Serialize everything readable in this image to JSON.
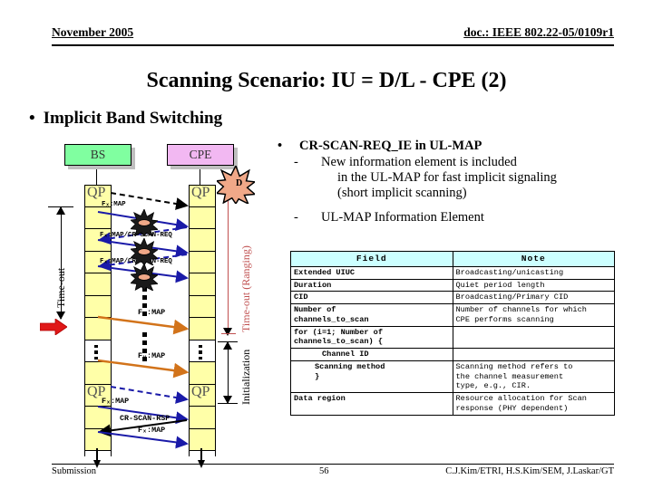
{
  "header": {
    "left": "November 2005",
    "right": "doc.: IEEE 802.22-05/0109r1"
  },
  "title": "Scanning Scenario: IU = D/L - CPE (2)",
  "main_bullet": {
    "marker": "•",
    "text": "Implicit Band Switching"
  },
  "right_text": {
    "bullet_marker": "•",
    "heading": "CR-SCAN-REQ_IE in UL-MAP",
    "dash": "-",
    "sub1_line1": "New information element is included",
    "sub1_line2": "in the UL-MAP for fast implicit signaling",
    "sub1_line3": "(short implicit scanning)",
    "sub2": "UL-MAP Information Element"
  },
  "table": {
    "headers": [
      "Field",
      "Note"
    ],
    "rows": [
      {
        "field": "Extended UIUC",
        "note": "Broadcasting/unicasting",
        "indent": 0
      },
      {
        "field": "Duration",
        "note": "Quiet period length",
        "indent": 0
      },
      {
        "field": "CID",
        "note": "Broadcasting/Primary CID",
        "indent": 0
      },
      {
        "field": "Number of\nchannels_to_scan",
        "note": "Number of channels for which\nCPE performs scanning",
        "indent": 0
      },
      {
        "field": "for (i=1; Number of\nchannels_to_scan) {",
        "note": "",
        "indent": 0
      },
      {
        "field": "Channel ID",
        "note": "",
        "indent": 1
      },
      {
        "field": "Scanning method\n}",
        "note": "Scanning method refers to\nthe channel measurement\ntype, e.g., CIR.",
        "indent": 2
      },
      {
        "field": "Data region",
        "note": "Resource allocation for Scan\nresponse (PHY dependent)",
        "indent": 0
      }
    ],
    "header_bg": "#ccffff"
  },
  "diagram": {
    "bs_label": "BS",
    "cpe_label": "CPE",
    "bs_color": "#80ffa0",
    "cpe_color": "#f2b8f2",
    "cell_color": "#ffffa8",
    "qp_label": "QP",
    "burst_d_label": "D",
    "burst_color": "#f0a888",
    "left_axis_label": "Time-out",
    "right_axis_label_1": "Time-out (Ranging)",
    "right_axis_label_1_color": "#c05050",
    "right_axis_label_2": "Initialization",
    "messages": [
      {
        "label": "",
        "kind": "dashed-black"
      },
      {
        "label": "Fₓ:MAP",
        "kind": "solid-blue"
      },
      {
        "label": "",
        "kind": "dashed-blue"
      },
      {
        "label": "Fₓ:MAP/CR-SCAN-REQ",
        "kind": "solid-blue"
      },
      {
        "label": "",
        "kind": "dashed-blue"
      },
      {
        "label": "Fₓ:MAP/CR-SCAN-REQ",
        "kind": "solid-blue"
      },
      {
        "label": "Fᵧ:MAP",
        "kind": "solid-orange"
      },
      {
        "label": "Fᵧ:MAP",
        "kind": "solid-orange"
      },
      {
        "label": "",
        "kind": "dashed-blue"
      },
      {
        "label": "Fₓ:MAP",
        "kind": "solid-blue"
      },
      {
        "label": "CR-SCAN-RSP",
        "kind": "solid-black"
      },
      {
        "label": "Fₓ:MAP",
        "kind": "solid-blue"
      }
    ],
    "red_marker": "red-arrow-marker"
  },
  "footer": {
    "left": "Submission",
    "page": "56",
    "right": "C.J.Kim/ETRI, H.S.Kim/SEM, J.Laskar/GT"
  }
}
